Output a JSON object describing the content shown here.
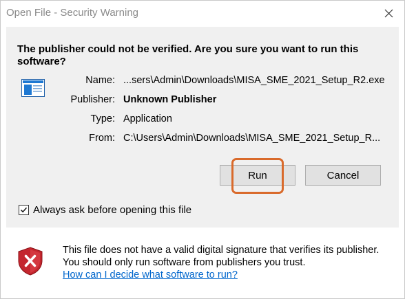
{
  "window": {
    "title": "Open File - Security Warning",
    "close_icon": "close-icon"
  },
  "main": {
    "question": "The publisher could not be verified.  Are you sure you want to run this software?",
    "app_icon": "application-window-icon",
    "fields": {
      "name_label": "Name:",
      "name_value": "...sers\\Admin\\Downloads\\MISA_SME_2021_Setup_R2.exe",
      "publisher_label": "Publisher:",
      "publisher_value": "Unknown Publisher",
      "type_label": "Type:",
      "type_value": "Application",
      "from_label": "From:",
      "from_value": "C:\\Users\\Admin\\Downloads\\MISA_SME_2021_Setup_R..."
    },
    "buttons": {
      "run_label": "Run",
      "cancel_label": "Cancel"
    },
    "checkbox": {
      "label": "Always ask before opening this file",
      "checked": true
    }
  },
  "warning": {
    "icon": "shield-x-icon",
    "text": "This file does not have a valid digital signature that verifies its publisher.  You should only run software from publishers you trust.",
    "link_text": "How can I decide what software to run?"
  },
  "colors": {
    "highlight": "#d96a2b",
    "link": "#0066cc",
    "shield_red": "#c4262e"
  }
}
